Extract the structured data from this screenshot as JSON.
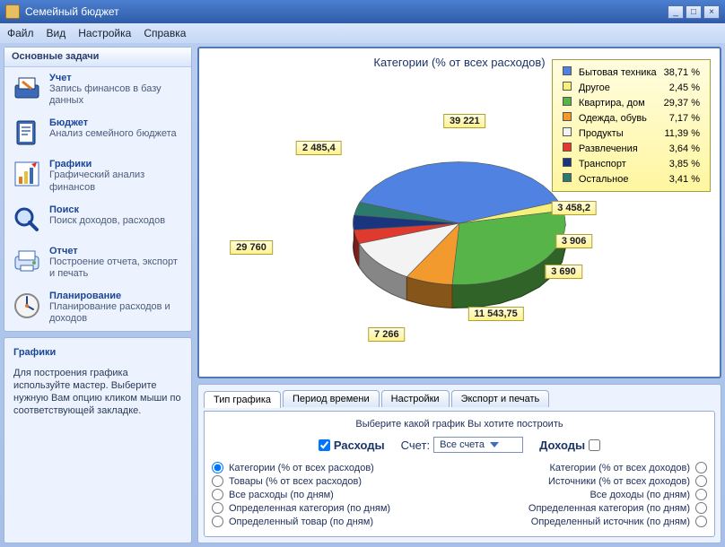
{
  "window": {
    "title": "Семейный бюджет"
  },
  "menu": {
    "file": "Файл",
    "view": "Вид",
    "settings": "Настройка",
    "help": "Справка"
  },
  "sidebar": {
    "header": "Основные задачи",
    "items": [
      {
        "title": "Учет",
        "desc": "Запись финансов в базу данных"
      },
      {
        "title": "Бюджет",
        "desc": "Анализ семейного бюджета"
      },
      {
        "title": "Графики",
        "desc": "Графический анализ финансов"
      },
      {
        "title": "Поиск",
        "desc": "Поиск доходов, расходов"
      },
      {
        "title": "Отчет",
        "desc": "Построение отчета, экспорт и печать"
      },
      {
        "title": "Планирование",
        "desc": "Планирование расходов и доходов"
      }
    ],
    "info_title": "Графики",
    "info_text": "Для построения графика используйте мастер. Выберите нужную Вам опцию кликом мыши по соответствующей закладке."
  },
  "chart": {
    "title": "Категории (% от всех расходов)"
  },
  "chart_data": {
    "type": "pie",
    "title": "Категории (% от всех расходов)",
    "series": [
      {
        "name": "Бытовая техника",
        "percent": 38.71,
        "color": "#4f82e1",
        "value_label": "39 221"
      },
      {
        "name": "Другое",
        "percent": 2.45,
        "color": "#f5f07a",
        "value_label": "2 485,4"
      },
      {
        "name": "Квартира, дом",
        "percent": 29.37,
        "color": "#56b449",
        "value_label": "29 760"
      },
      {
        "name": "Одежда, обувь",
        "percent": 7.17,
        "color": "#f29a2e",
        "value_label": "7 266"
      },
      {
        "name": "Продукты",
        "percent": 11.39,
        "color": "#f3f3f3",
        "value_label": "11 543,75"
      },
      {
        "name": "Развлечения",
        "percent": 3.64,
        "color": "#e03a2f",
        "value_label": "3 690"
      },
      {
        "name": "Транспорт",
        "percent": 3.85,
        "color": "#18357e",
        "value_label": "3 906"
      },
      {
        "name": "Остальное",
        "percent": 3.41,
        "color": "#2c7a6e",
        "value_label": "3 458,2"
      }
    ]
  },
  "tabs": {
    "t0": "Тип графика",
    "t1": "Период времени",
    "t2": "Настройки",
    "t3": "Экспорт и печать"
  },
  "wizard": {
    "prompt": "Выберите какой график Вы хотите построить",
    "expenses": "Расходы",
    "account_label": "Счет:",
    "account_value": "Все счета",
    "income": "Доходы",
    "left": [
      "Категории (% от всех расходов)",
      "Товары (% от всех расходов)",
      "Все расходы (по дням)",
      "Определенная категория (по дням)",
      "Определенный товар (по дням)"
    ],
    "right": [
      "Категории (% от всех доходов)",
      "Источники (% от всех доходов)",
      "Все доходы (по дням)",
      "Определенная категория (по дням)",
      "Определенный источник (по дням)"
    ]
  }
}
